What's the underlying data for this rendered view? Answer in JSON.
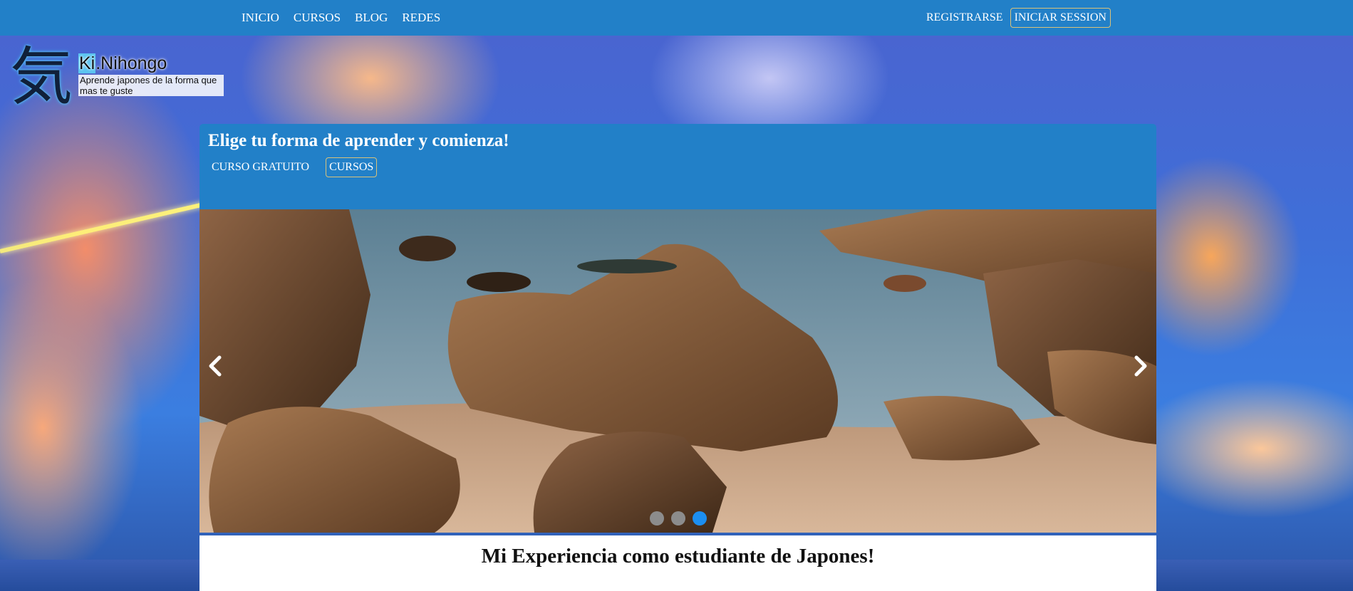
{
  "nav": {
    "links": [
      "INICIO",
      "CURSOS",
      "BLOG",
      "REDES"
    ],
    "register": "REGISTRARSE",
    "login": "INICIAR SESSION"
  },
  "logo": {
    "kanji": "気",
    "ki": "Ki",
    "name_rest": ".Nihongo",
    "tagline": "Aprende japones de la forma que mas te guste"
  },
  "panel": {
    "title": "Elige tu forma de aprender y comienza!",
    "tabs": [
      {
        "label": "CURSO GRATUITO",
        "active": false
      },
      {
        "label": "CURSOS",
        "active": true
      }
    ]
  },
  "carousel": {
    "slide_count": 3,
    "active_index": 2
  },
  "content": {
    "heading": "Mi Experiencia como estudiante de Japones!"
  },
  "colors": {
    "primary": "#2280c8",
    "active_dot": "#1c8ef0",
    "outline": "#d9c27a"
  }
}
